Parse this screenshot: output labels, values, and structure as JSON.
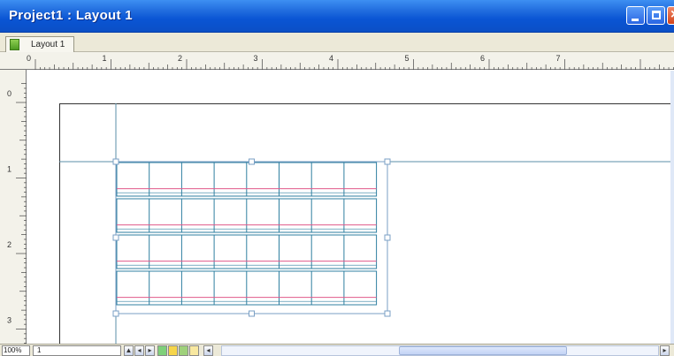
{
  "window": {
    "title": "Project1 : Layout 1"
  },
  "tabs": [
    {
      "label": "Layout 1"
    }
  ],
  "ruler": {
    "horizontal_labels": [
      "0",
      "1",
      "2",
      "3",
      "4",
      "5",
      "6",
      "7"
    ],
    "vertical_labels": [
      "0",
      "1",
      "2",
      "3"
    ]
  },
  "statusbar": {
    "zoom": "100%",
    "page": "1"
  },
  "colors": {
    "titlebar": "#0a55d4",
    "guide": "#5b8fa8",
    "grid_line": "#2f7fa0",
    "baseline": "#e05a8a",
    "selection": "#7a9fc4"
  },
  "icons": {
    "minimize": "minimize-icon",
    "maximize": "maximize-icon",
    "close": "close-icon",
    "layout_tab": "layout-icon"
  }
}
